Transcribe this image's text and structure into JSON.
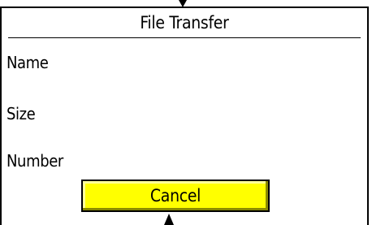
{
  "dialog": {
    "title": "File Transfer",
    "fields": {
      "name_label": "Name",
      "size_label": "Size",
      "number_label": "Number"
    },
    "cancel_label": "Cancel",
    "colors": {
      "button_fill": "#ffff00",
      "border": "#000000",
      "background": "#ffffff"
    }
  }
}
